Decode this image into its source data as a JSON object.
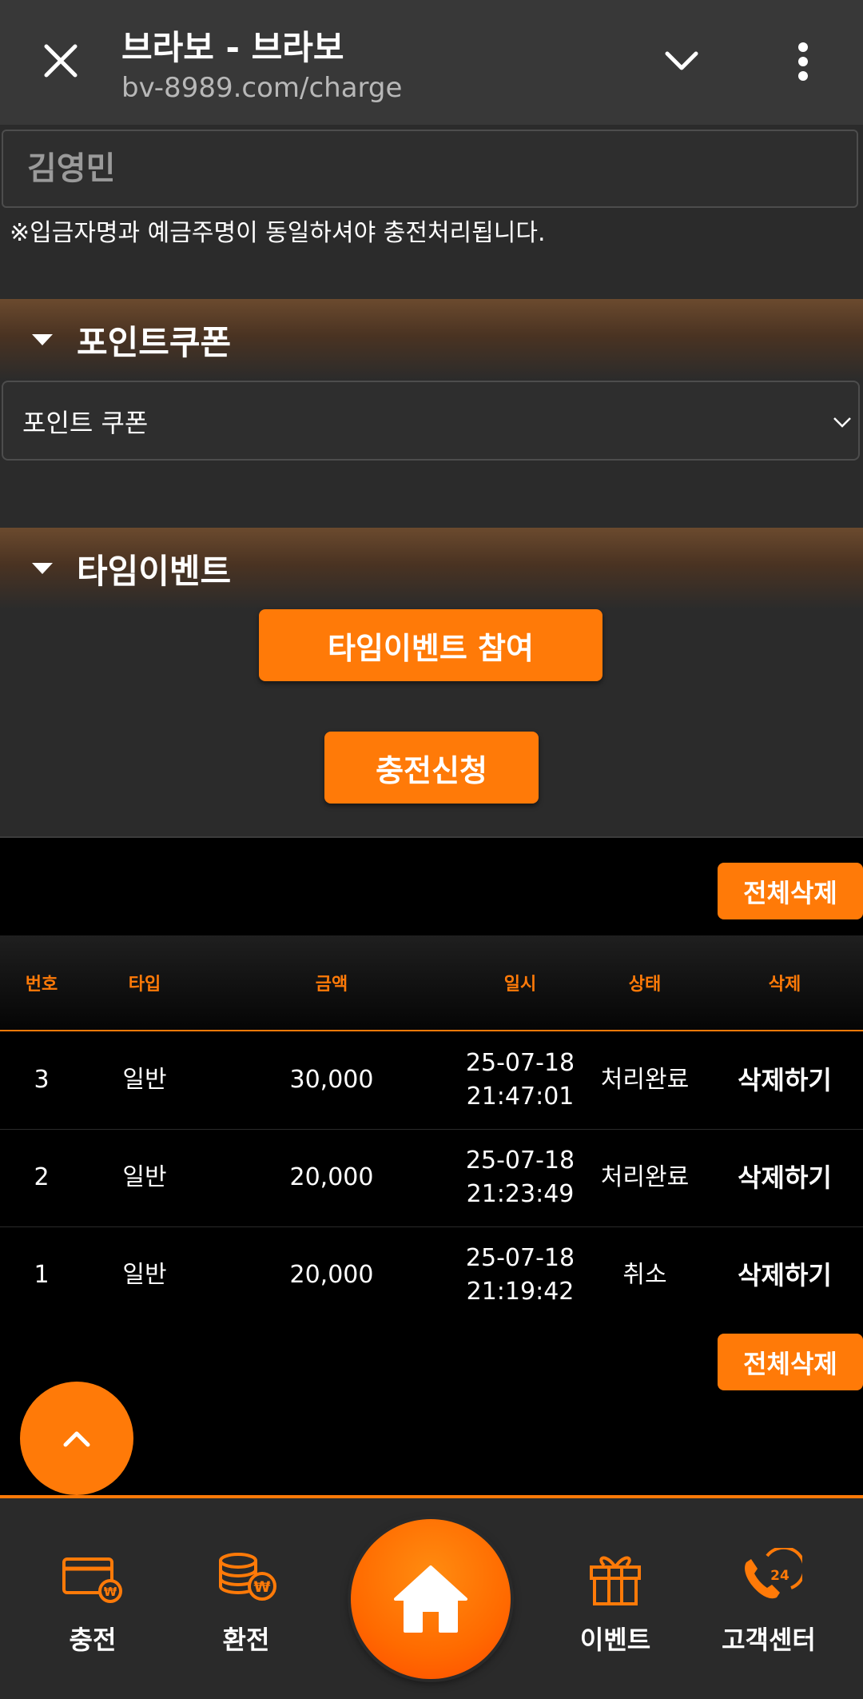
{
  "browser": {
    "title": "브라보 - 브라보",
    "url": "bv-8989.com/charge"
  },
  "form": {
    "depositor_name": "김영민",
    "notice": "※입금자명과 예금주명이 동일하셔야 충전처리됩니다.",
    "point_coupon_header": "포인트쿠폰",
    "coupon_select_value": "포인트 쿠폰",
    "time_event_header": "타임이벤트",
    "time_event_button": "타임이벤트 참여",
    "charge_button": "충전신청"
  },
  "history": {
    "delete_all": "전체삭제",
    "columns": [
      "번호",
      "타입",
      "금액",
      "일시",
      "상태",
      "삭제"
    ],
    "rows": [
      {
        "no": "3",
        "type": "일반",
        "amount": "30,000",
        "date": "25-07-18",
        "time": "21:47:01",
        "status": "처리완료",
        "action": "삭제하기"
      },
      {
        "no": "2",
        "type": "일반",
        "amount": "20,000",
        "date": "25-07-18",
        "time": "21:23:49",
        "status": "처리완료",
        "action": "삭제하기"
      },
      {
        "no": "1",
        "type": "일반",
        "amount": "20,000",
        "date": "25-07-18",
        "time": "21:19:42",
        "status": "취소",
        "action": "삭제하기"
      }
    ]
  },
  "nav": {
    "charge": "충전",
    "withdraw": "환전",
    "event": "이벤트",
    "support": "고객센터",
    "support_badge": "24"
  },
  "icons": {
    "close": "close-icon",
    "chevron": "chevron-down-icon",
    "more": "more-vert-icon",
    "scroll_top": "chevron-up-icon",
    "home": "home-icon"
  },
  "colors": {
    "accent": "#ff7a08",
    "topbar": "#383838",
    "form_bg": "#2b2b2b",
    "nav_bg": "#2a2a2a"
  }
}
